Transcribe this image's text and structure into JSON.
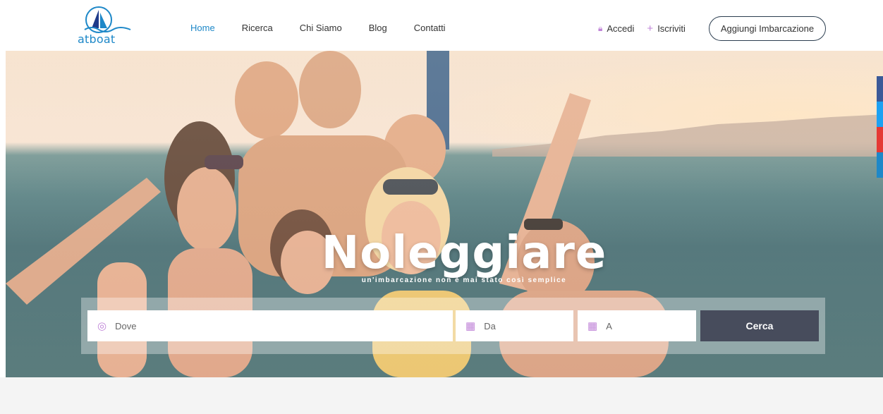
{
  "brand": {
    "name": "atboat",
    "color": "#1e88c8"
  },
  "nav": {
    "items": [
      {
        "label": "Home",
        "active": true
      },
      {
        "label": "Ricerca",
        "active": false
      },
      {
        "label": "Chi Siamo",
        "active": false
      },
      {
        "label": "Blog",
        "active": false
      },
      {
        "label": "Contatti",
        "active": false
      }
    ]
  },
  "auth": {
    "login_label": "Accedi",
    "login_icon": "lock-icon",
    "register_label": "Iscriviti",
    "register_icon": "plus-icon"
  },
  "cta": {
    "add_boat_label": "Aggiungi Imbarcazione"
  },
  "hero": {
    "title": "Noleggiare",
    "subtitle": "un'imbarcazione non è mai stato così semplice"
  },
  "search": {
    "where_placeholder": "Dove",
    "where_icon": "map-pin-icon",
    "from_placeholder": "Da",
    "from_icon": "calendar-icon",
    "to_placeholder": "A",
    "to_icon": "calendar-icon",
    "submit_label": "Cerca",
    "submit_color": "#474c5c"
  },
  "social_colors": [
    "#3b5998",
    "#1da1f2",
    "#e53935",
    "#1e88c8"
  ]
}
